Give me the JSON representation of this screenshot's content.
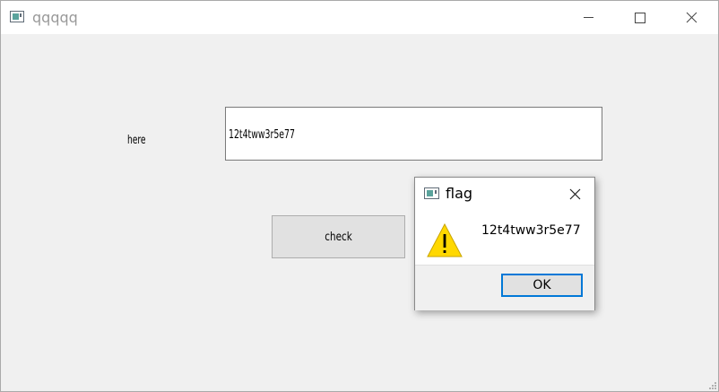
{
  "window": {
    "title": "qqqqq"
  },
  "form": {
    "label": "here",
    "input_value": "12t4tww3r5e77",
    "check_button_label": "check"
  },
  "dialog": {
    "title": "flag",
    "message": "12t4tww3r5e77",
    "ok_label": "OK",
    "icon": "warning-icon"
  },
  "icons": {
    "app": "app-window-icon",
    "minimize": "minimize-icon",
    "maximize": "maximize-icon",
    "close": "close-icon"
  },
  "colors": {
    "titlebar": "#ffffff",
    "client_bg": "#f0f0f0",
    "button_bg": "#e1e1e1",
    "accent": "#0078d7",
    "warning": "#ffd800"
  }
}
